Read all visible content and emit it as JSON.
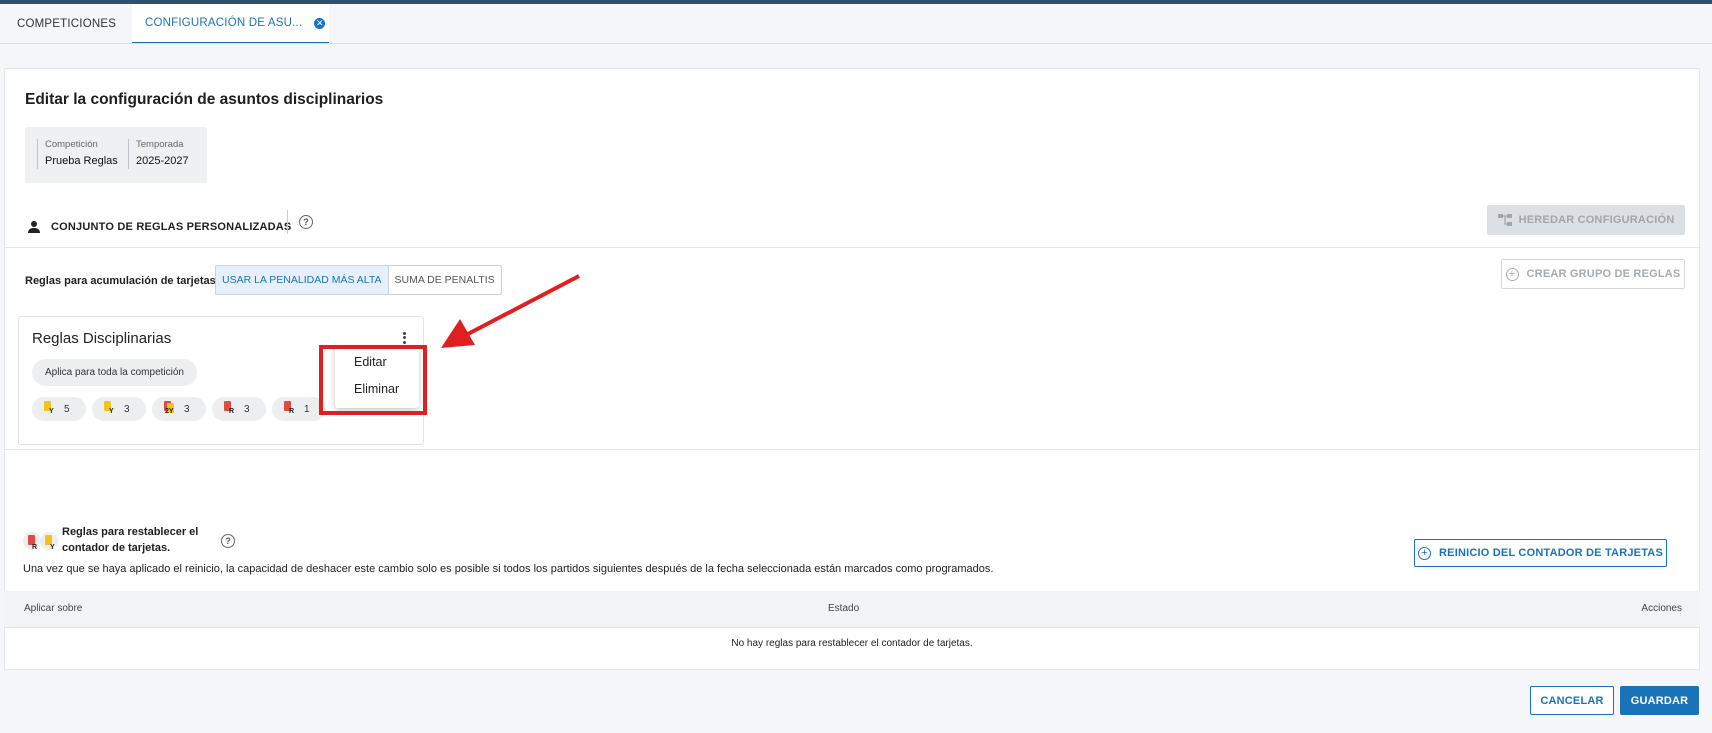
{
  "tabs": [
    {
      "label": "COMPETICIONES"
    },
    {
      "label": "CONFIGURACIÓN DE ASU..."
    }
  ],
  "page": {
    "title": "Editar la configuración de asuntos disciplinarios",
    "meta": {
      "competition_label": "Competición",
      "competition_value": "Prueba Reglas",
      "season_label": "Temporada",
      "season_value": "2025-2027"
    },
    "ruleset_label": "CONJUNTO DE REGLAS PERSONALIZADAS",
    "inherit_button": "HEREDAR CONFIGURACIÓN"
  },
  "accumulation": {
    "label": "Reglas para acumulación de tarjetas",
    "options": [
      "USAR LA PENALIDAD MÁS ALTA",
      "SUMA DE PENALTIS"
    ],
    "selected": "USAR LA PENALIDAD MÁS ALTA",
    "create_group_button": "CREAR GRUPO DE REGLAS"
  },
  "rule_card": {
    "title": "Reglas Disciplinarias",
    "scope": "Aplica para toda la competición",
    "card_chips": [
      {
        "type": "Y",
        "count": "5"
      },
      {
        "type": "Y",
        "count": "3"
      },
      {
        "type": "2Y",
        "count": "3"
      },
      {
        "type": "R",
        "count": "3"
      },
      {
        "type": "R",
        "count": "1"
      }
    ],
    "menu": [
      "Editar",
      "Eliminar"
    ]
  },
  "reset": {
    "title": "Reglas para restablecer el contador de tarjetas.",
    "note": "Una vez que se haya aplicado el reinicio, la capacidad de deshacer este cambio solo es posible si todos los partidos siguientes después de la fecha seleccionada están marcados como programados.",
    "button": "REINICIO DEL CONTADOR DE TARJETAS",
    "columns": [
      "Aplicar sobre",
      "Estado",
      "Acciones"
    ],
    "empty_text": "No hay reglas para restablecer el contador de tarjetas."
  },
  "footer": {
    "cancel": "CANCELAR",
    "save": "GUARDAR"
  },
  "colors": {
    "accent": "#1a73b8",
    "yellow_card": "#f2c318",
    "red_card": "#e2493f",
    "annotation_red": "#e02020"
  }
}
